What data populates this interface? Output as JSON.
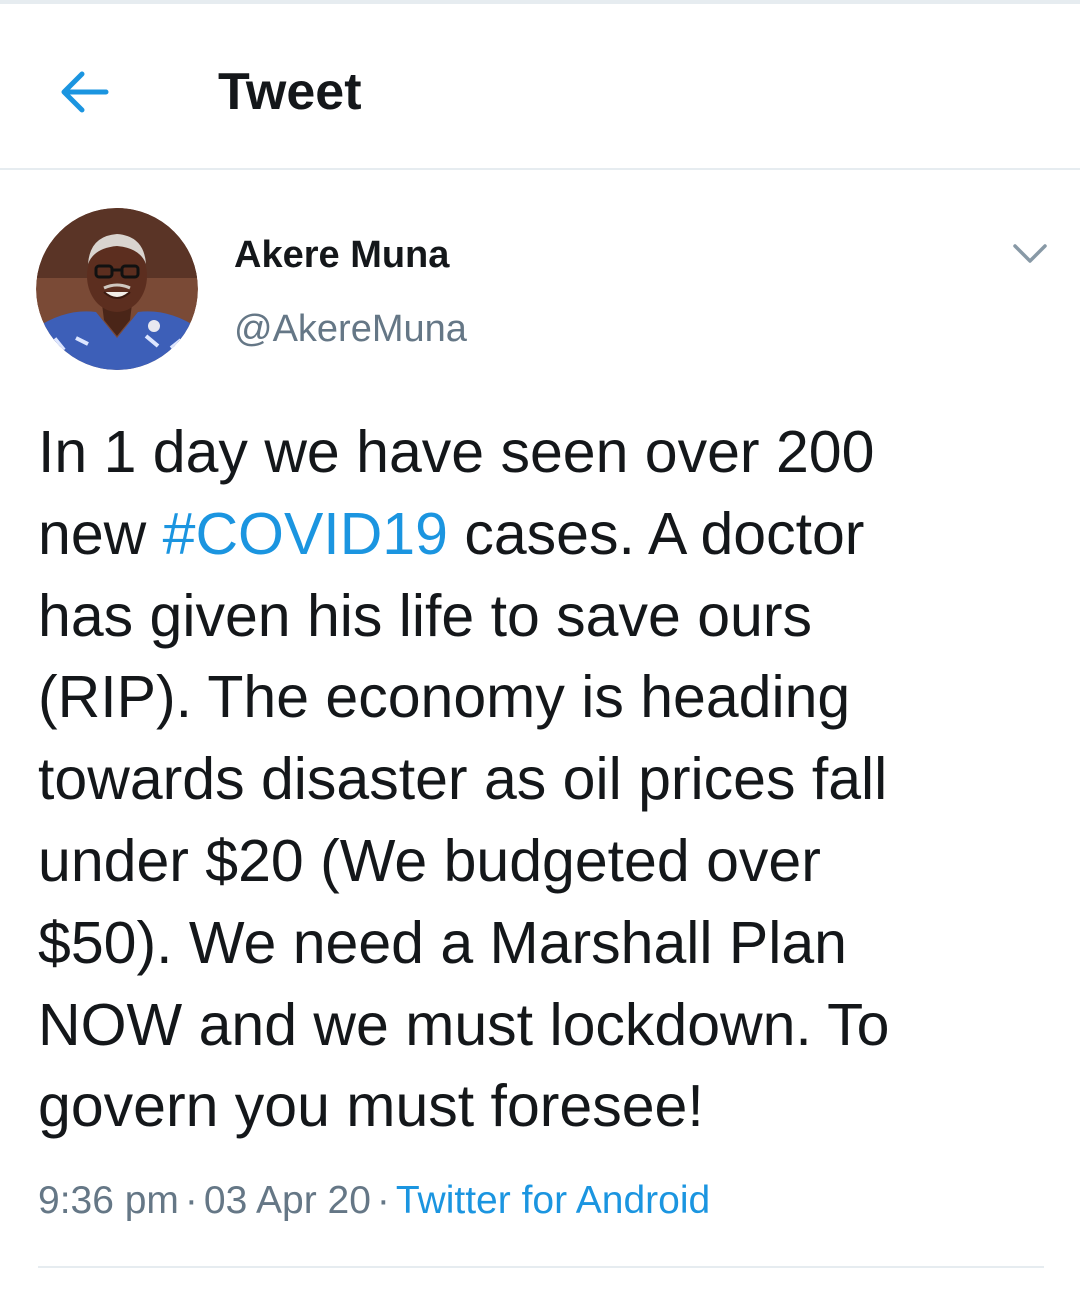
{
  "header": {
    "title": "Tweet",
    "back_icon": "arrow-left-icon"
  },
  "colors": {
    "accent": "#1b95e0",
    "text_primary": "#14171a",
    "text_secondary": "#657786",
    "divider": "#e6ecf0"
  },
  "tweet": {
    "author": {
      "name": "Akere Muna",
      "handle": "@AkereMuna",
      "avatar_icon": "user-avatar-icon"
    },
    "menu_icon": "chevron-down-icon",
    "text_lines": [
      {
        "before": "In 1 day we have seen over 200"
      },
      {
        "before": "new ",
        "hashtag": "#COVID19",
        "after": " cases. A doctor"
      },
      {
        "before": "has given his life to save ours"
      },
      {
        "before": "(RIP). The economy is heading"
      },
      {
        "before": "towards disaster as oil prices fall"
      },
      {
        "before": "under $20 (We budgeted over"
      },
      {
        "before": "$50). We need a Marshall Plan"
      },
      {
        "before": "NOW and we must lockdown. To"
      },
      {
        "before": "govern you must foresee!"
      }
    ],
    "time": "9:36 pm",
    "separator": "·",
    "date": "03 Apr 20",
    "source": "Twitter for Android"
  }
}
